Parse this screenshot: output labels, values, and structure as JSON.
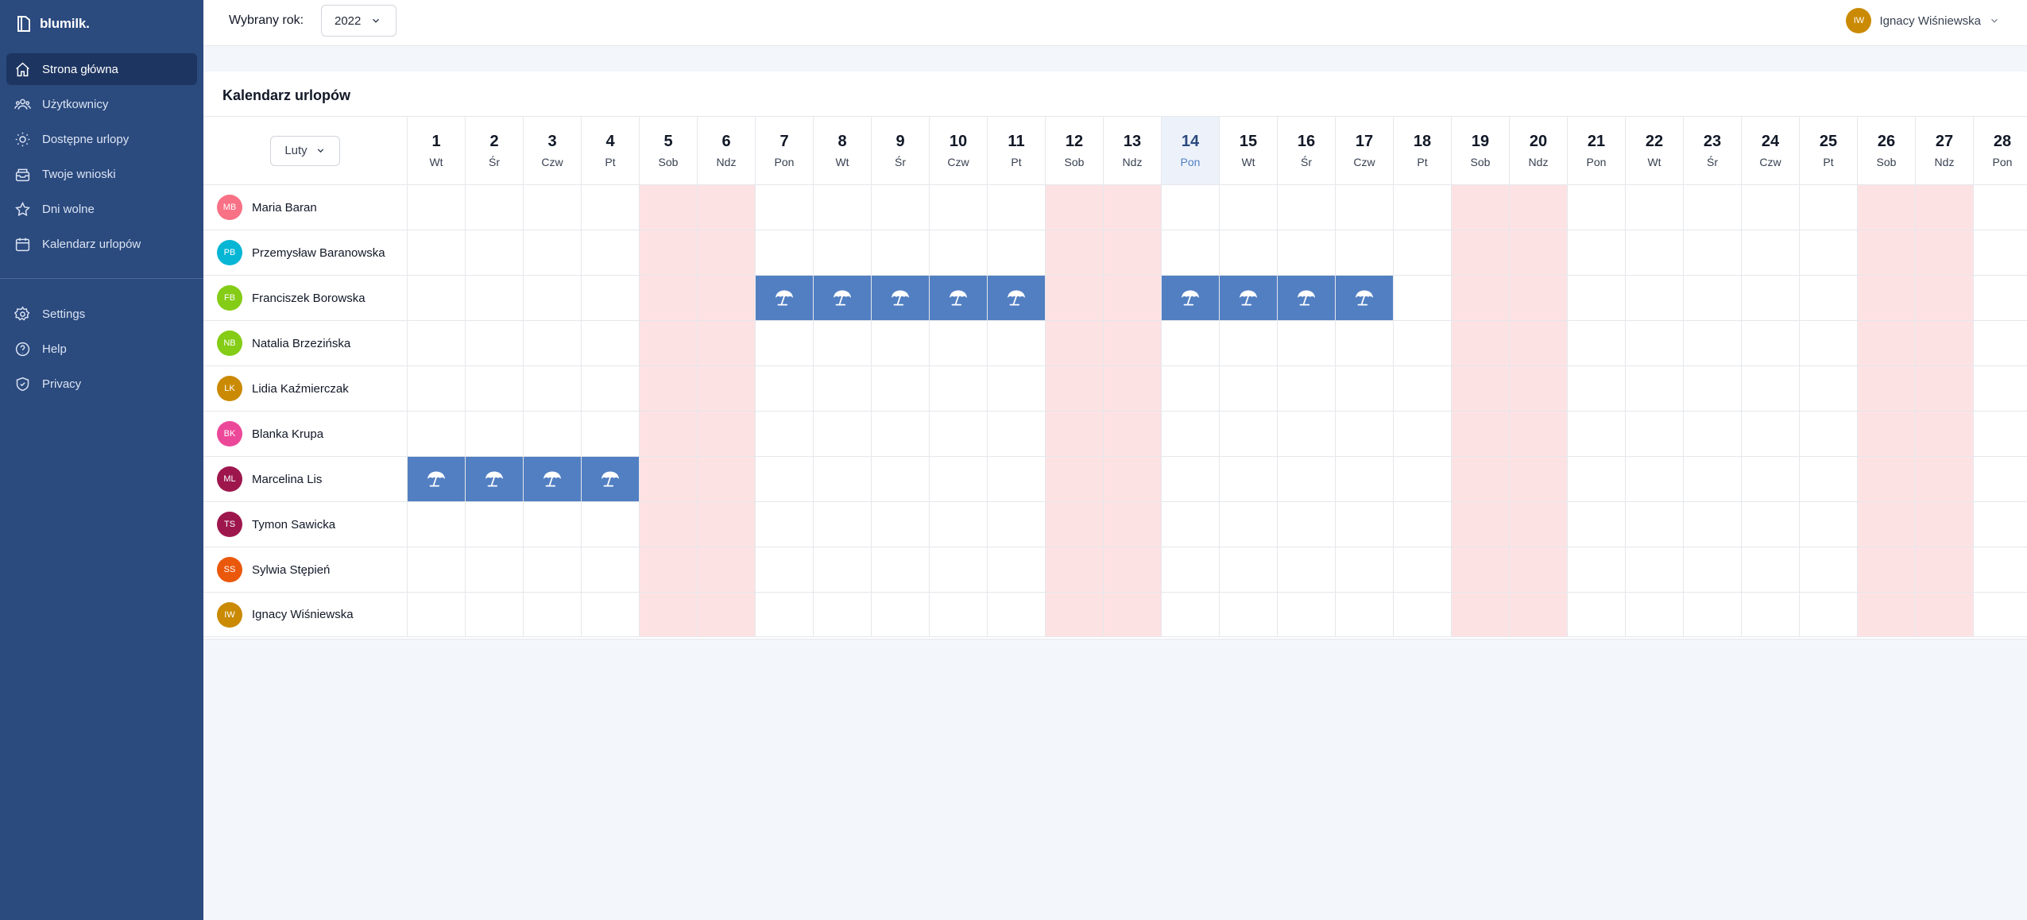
{
  "app": {
    "logo_text": "blumilk."
  },
  "sidebar": {
    "items": [
      {
        "label": "Strona główna",
        "icon": "home-icon",
        "active": true
      },
      {
        "label": "Użytkownicy",
        "icon": "users-icon"
      },
      {
        "label": "Dostępne urlopy",
        "icon": "sun-icon"
      },
      {
        "label": "Twoje wnioski",
        "icon": "inbox-icon"
      },
      {
        "label": "Dni wolne",
        "icon": "star-icon"
      },
      {
        "label": "Kalendarz urlopów",
        "icon": "calendar-icon"
      }
    ],
    "secondary": [
      {
        "label": "Settings",
        "icon": "gear-icon"
      },
      {
        "label": "Help",
        "icon": "help-icon"
      },
      {
        "label": "Privacy",
        "icon": "shield-icon"
      }
    ]
  },
  "topbar": {
    "year_label": "Wybrany rok:",
    "year_value": "2022",
    "user_name": "Ignacy Wiśniewska",
    "user_initials": "IW",
    "user_color": "#ca8a04"
  },
  "calendar": {
    "title": "Kalendarz urlopów",
    "month": "Luty",
    "today": 14,
    "days": [
      {
        "n": "1",
        "d": "Wt"
      },
      {
        "n": "2",
        "d": "Śr"
      },
      {
        "n": "3",
        "d": "Czw"
      },
      {
        "n": "4",
        "d": "Pt"
      },
      {
        "n": "5",
        "d": "Sob",
        "w": true
      },
      {
        "n": "6",
        "d": "Ndz",
        "w": true
      },
      {
        "n": "7",
        "d": "Pon"
      },
      {
        "n": "8",
        "d": "Wt"
      },
      {
        "n": "9",
        "d": "Śr"
      },
      {
        "n": "10",
        "d": "Czw"
      },
      {
        "n": "11",
        "d": "Pt"
      },
      {
        "n": "12",
        "d": "Sob",
        "w": true
      },
      {
        "n": "13",
        "d": "Ndz",
        "w": true
      },
      {
        "n": "14",
        "d": "Pon"
      },
      {
        "n": "15",
        "d": "Wt"
      },
      {
        "n": "16",
        "d": "Śr"
      },
      {
        "n": "17",
        "d": "Czw"
      },
      {
        "n": "18",
        "d": "Pt"
      },
      {
        "n": "19",
        "d": "Sob",
        "w": true
      },
      {
        "n": "20",
        "d": "Ndz",
        "w": true
      },
      {
        "n": "21",
        "d": "Pon"
      },
      {
        "n": "22",
        "d": "Wt"
      },
      {
        "n": "23",
        "d": "Śr"
      },
      {
        "n": "24",
        "d": "Czw"
      },
      {
        "n": "25",
        "d": "Pt"
      },
      {
        "n": "26",
        "d": "Sob",
        "w": true
      },
      {
        "n": "27",
        "d": "Ndz",
        "w": true
      },
      {
        "n": "28",
        "d": "Pon"
      }
    ],
    "users": [
      {
        "name": "Maria Baran",
        "initials": "MB",
        "color": "#f87185",
        "leave": []
      },
      {
        "name": "Przemysław Baranowska",
        "initials": "PB",
        "color": "#06b6d4",
        "leave": []
      },
      {
        "name": "Franciszek Borowska",
        "initials": "FB",
        "color": "#84cc16",
        "leave": [
          7,
          8,
          9,
          10,
          11,
          14,
          15,
          16,
          17
        ]
      },
      {
        "name": "Natalia Brzezińska",
        "initials": "NB",
        "color": "#84cc16",
        "leave": []
      },
      {
        "name": "Lidia Kaźmierczak",
        "initials": "LK",
        "color": "#ca8a04",
        "leave": []
      },
      {
        "name": "Blanka Krupa",
        "initials": "BK",
        "color": "#ec4899",
        "leave": []
      },
      {
        "name": "Marcelina Lis",
        "initials": "ML",
        "color": "#9d174d",
        "leave": [
          1,
          2,
          3,
          4
        ]
      },
      {
        "name": "Tymon Sawicka",
        "initials": "TS",
        "color": "#9d174d",
        "leave": []
      },
      {
        "name": "Sylwia Stępień",
        "initials": "SS",
        "color": "#ea580c",
        "leave": []
      },
      {
        "name": "Ignacy Wiśniewska",
        "initials": "IW",
        "color": "#ca8a04",
        "leave": []
      }
    ]
  }
}
